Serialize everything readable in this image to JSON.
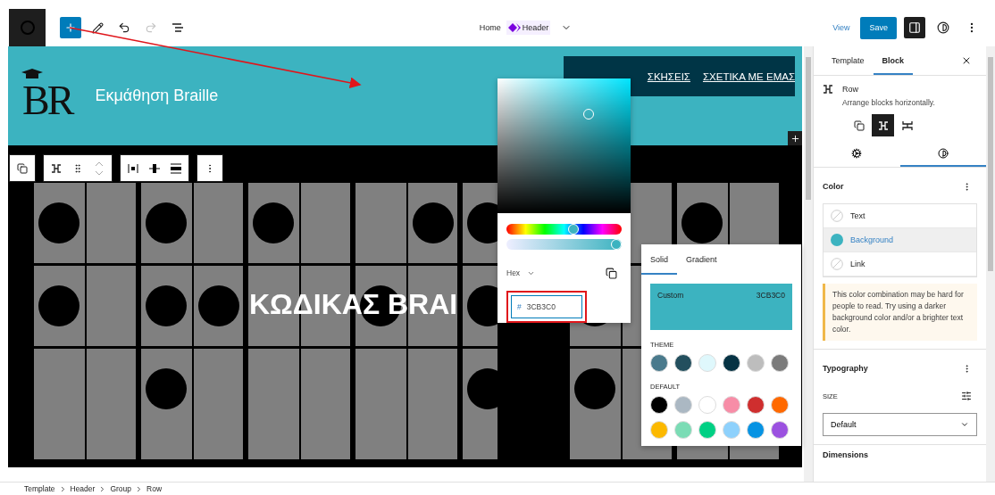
{
  "top_bar": {
    "redo_disabled": true,
    "settings_open": true,
    "home_label": "Home",
    "template_name": "Header",
    "view_label": "View",
    "save_label": "Save"
  },
  "canvas": {
    "logo_text": "BR",
    "site_title": "Εκμάθηση Braille",
    "nav_links": [
      "ΣΚΗΣΕΙΣ",
      "ΣΧΕΤΙΚΑ ΜΕ ΕΜΑΣ"
    ],
    "hero_text": "ΚΩΔΙΚΑΣ BRAI"
  },
  "color_picker": {
    "hue_slider": {
      "level": 0.59
    },
    "alpha_slider": {
      "level": 1
    },
    "format": "Hex",
    "hex_prefix": "#",
    "hex_value": "3CB3C0"
  },
  "palette": {
    "tabs": [
      {
        "label": "Solid",
        "selected": true
      },
      {
        "label": "Gradient",
        "selected": false
      }
    ],
    "custom": {
      "label": "Custom",
      "value": "3CB3C0",
      "color": "#3cb3c0"
    },
    "groups": [
      {
        "title": "THEME",
        "swatches": [
          {
            "color": "#4a7a8c"
          },
          {
            "color": "#234f5e"
          },
          {
            "color": "#dff8fc"
          },
          {
            "color": "#063344"
          },
          {
            "color": "#bdbdbd"
          },
          {
            "color": "#7b7b7b"
          }
        ]
      },
      {
        "title": "DEFAULT",
        "swatches": [
          {
            "color": "#000000"
          },
          {
            "color": "#abb8c3"
          },
          {
            "color": "#ffffff"
          },
          {
            "color": "#f78da7"
          },
          {
            "color": "#cf2e2e"
          },
          {
            "color": "#ff6900"
          },
          {
            "color": "#fcb900"
          },
          {
            "color": "#7bdcb5"
          },
          {
            "color": "#00d084"
          },
          {
            "color": "#8ed1fc"
          },
          {
            "color": "#0693e3"
          },
          {
            "color": "#9b51e0"
          }
        ]
      }
    ]
  },
  "sidebar": {
    "tabs": [
      {
        "label": "Template",
        "selected": false
      },
      {
        "label": "Block",
        "selected": true
      }
    ],
    "block": {
      "name": "Row",
      "description": "Arrange blocks horizontally."
    },
    "variations": [
      {
        "kind": "group",
        "selected": false
      },
      {
        "kind": "row",
        "selected": true
      },
      {
        "kind": "stack",
        "selected": false
      }
    ],
    "panel_tabs": [
      {
        "kind": "settings",
        "selected": false
      },
      {
        "kind": "styles",
        "selected": true
      }
    ],
    "color": {
      "title": "Color",
      "items": [
        {
          "label": "Text",
          "selected": false
        },
        {
          "label": "Background",
          "selected": true,
          "color": "#3cb3c0"
        },
        {
          "label": "Link",
          "selected": false
        }
      ]
    },
    "notice": "This color combination may be hard for people to read. Try using a darker background color and/or a brighter text color.",
    "typography": {
      "title": "Typography",
      "size_label": "SIZE",
      "select_value": "Default"
    },
    "dimensions_title": "Dimensions"
  },
  "breadcrumb": [
    "Template",
    "Header",
    "Group",
    "Row"
  ]
}
